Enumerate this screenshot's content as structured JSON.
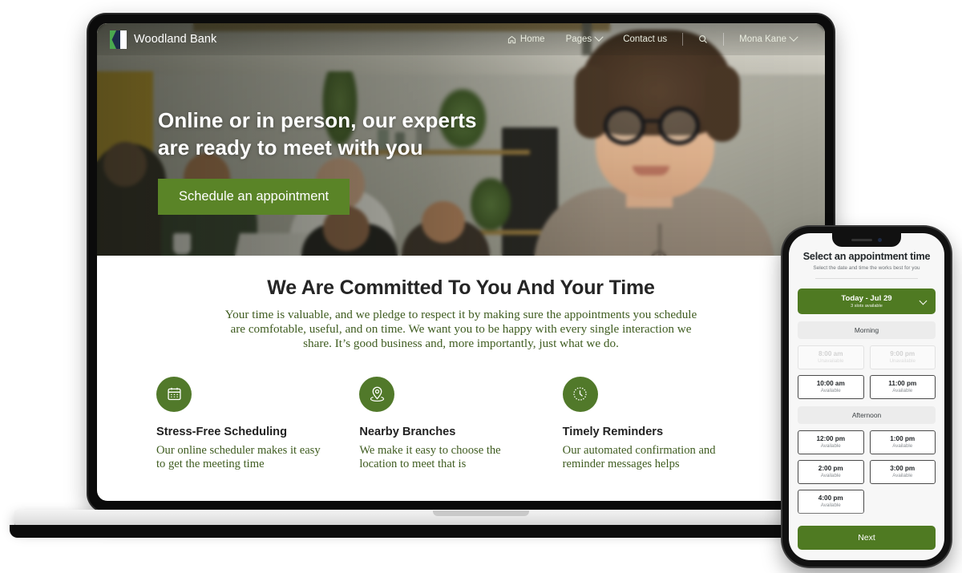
{
  "site": {
    "brand": {
      "name": "Woodland Bank",
      "logo_icon": "woodland-logo-icon"
    },
    "nav": {
      "home": "Home",
      "home_icon": "home-icon",
      "pages": "Pages",
      "pages_chevron_icon": "chevron-down-icon",
      "contact": "Contact us",
      "search_icon": "search-icon",
      "user": "Mona Kane",
      "user_chevron_icon": "chevron-down-icon"
    },
    "hero": {
      "title_line1": "Online or in person, our experts",
      "title_line2": "are ready to meet with you",
      "cta": "Schedule an appointment"
    },
    "committed": {
      "heading": "We Are Committed To You And Your Time",
      "paragraph": "Your time is valuable, and we pledge to respect it by making sure the appointments you schedule are comfotable, useful, and on time. We want you to be happy with every single interaction we share. It’s good business and, more importantly, just what we do."
    },
    "features": [
      {
        "icon": "calendar-icon",
        "title": "Stress-Free Scheduling",
        "body": "Our online scheduler makes it easy to get the meeting time"
      },
      {
        "icon": "map-pin-icon",
        "title": "Nearby Branches",
        "body": "We make it easy to choose the location to meet that is"
      },
      {
        "icon": "clock-icon",
        "title": "Timely Reminders",
        "body": "Our automated confirmation and reminder messages helps"
      }
    ],
    "colors": {
      "primary_green": "#5a8427",
      "icon_green": "#51792a",
      "body_green": "#3f5c20",
      "heading_dark": "#252525"
    }
  },
  "phone": {
    "title": "Select an appointment time",
    "subtitle": "Select the date and time the works best for you",
    "date_selector": {
      "label": "Today - Jul 29",
      "slots_note": "3 slots available",
      "chevron_icon": "chevron-down-icon"
    },
    "sections": [
      {
        "label": "Morning",
        "slots": [
          {
            "time": "8:00 am",
            "status": "Unavailable",
            "available": false
          },
          {
            "time": "9:00 pm",
            "status": "Unavailable",
            "available": false
          },
          {
            "time": "10:00 am",
            "status": "Available",
            "available": true
          },
          {
            "time": "11:00 pm",
            "status": "Available",
            "available": true
          }
        ]
      },
      {
        "label": "Afternoon",
        "slots": [
          {
            "time": "12:00 pm",
            "status": "Available",
            "available": true
          },
          {
            "time": "1:00 pm",
            "status": "Available",
            "available": true
          },
          {
            "time": "2:00 pm",
            "status": "Available",
            "available": true
          },
          {
            "time": "3:00 pm",
            "status": "Available",
            "available": true
          },
          {
            "time": "4:00 pm",
            "status": "Available",
            "available": true
          }
        ]
      }
    ],
    "next_button": "Next"
  }
}
